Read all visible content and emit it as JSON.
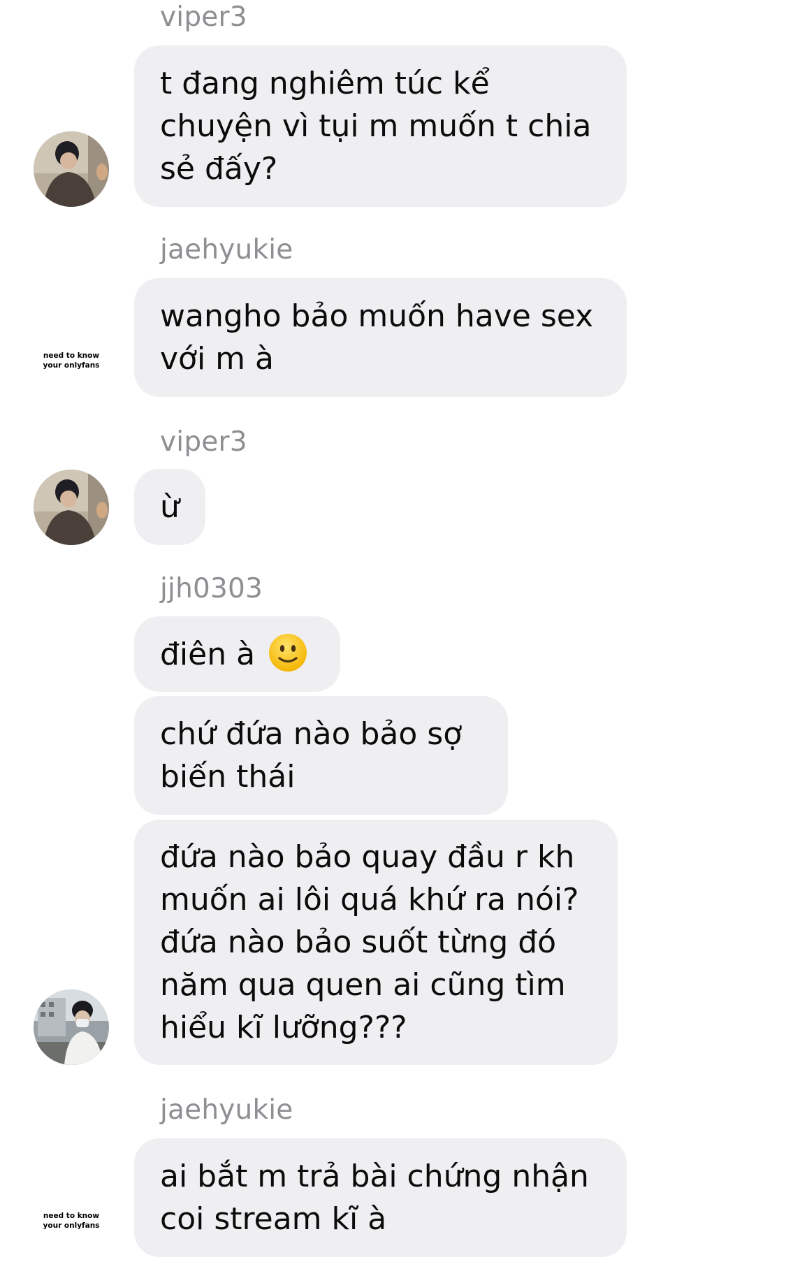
{
  "messages": [
    {
      "sender": "viper3",
      "bubbles": [
        "t đang nghiêm túc kể chuyện vì tụi m muốn t chia sẻ đấy?"
      ]
    },
    {
      "sender": "jaehyukie",
      "bubbles": [
        "wangho bảo muốn have sex với m à"
      ],
      "avatar_caption": [
        "need to know",
        "your onlyfans"
      ]
    },
    {
      "sender": "viper3",
      "bubbles": [
        "ừ"
      ]
    },
    {
      "sender": "jjh0303",
      "bubbles": [
        "điên à",
        "chứ đứa nào bảo sợ biến thái",
        "đứa nào bảo quay đầu r kh muốn ai lôi quá khứ ra nói? đứa nào bảo suốt từng đó năm qua quen ai cũng tìm hiểu kĩ lưỡng???"
      ]
    },
    {
      "sender": "jaehyukie",
      "bubbles": [
        "ai bắt m trả bài chứng nhận coi stream kĩ à"
      ],
      "avatar_caption": [
        "need to know",
        "your onlyfans"
      ]
    }
  ],
  "icons": {
    "avatar_viper3": "photo-avatar",
    "avatar_jjh0303": "photo-avatar",
    "emoji_slight_smile": "slightly-smiling-face"
  },
  "colors": {
    "bubble_bg": "#efeff2",
    "sender_text": "#8e8e93",
    "message_text": "#0b0b0b"
  }
}
